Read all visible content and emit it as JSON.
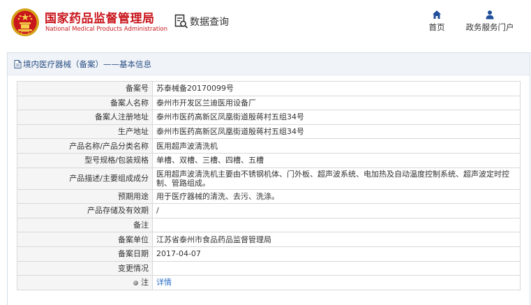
{
  "header": {
    "title_cn": "国家药品监督管理局",
    "title_en": "National Medical Products Administration",
    "query_label": "数据查询",
    "nav": {
      "home": "首页",
      "portal": "政务服务门户"
    }
  },
  "breadcrumb": "境内医疗器械（备案）——基本信息",
  "rows": [
    {
      "label": "备案号",
      "value": "苏泰械备20170099号"
    },
    {
      "label": "备案人名称",
      "value": "泰州市开发区兰迪医用设备厂"
    },
    {
      "label": "备案人注册地址",
      "value": "泰州市医药高新区凤凰街道殷蒋村五组34号"
    },
    {
      "label": "生产地址",
      "value": "泰州市医药高新区凤凰街道殷蒋村五组34号"
    },
    {
      "label": "产品名称/产品分类名称",
      "value": "医用超声波清洗机"
    },
    {
      "label": "型号规格/包装规格",
      "value": "单槽、双槽、三槽、四槽、五槽"
    },
    {
      "label": "产品描述/主要组成成分",
      "value": "医用超声波清洗机主要由不锈钢机体、门外板、超声波系统、电加热及自动温度控制系统、超声波定时控制、管路组成。"
    },
    {
      "label": "预期用途",
      "value": "用于医疗器械的清洗、去污、洗涤。"
    },
    {
      "label": "产品存储及有效期",
      "value": "/"
    },
    {
      "label": "备注",
      "value": ""
    },
    {
      "label": "备案单位",
      "value": "江苏省泰州市食品药品监督管理局"
    },
    {
      "label": "备案日期",
      "value": "2017-04-07"
    },
    {
      "label": "变更情况",
      "value": ""
    },
    {
      "label": "注",
      "value": "详情"
    }
  ],
  "colors": {
    "brand_red": "#c9161c",
    "link_blue": "#2a6ec6",
    "nav_blue": "#1f4f9b"
  },
  "icons": {
    "emblem": "national-emblem",
    "query": "search-document-icon",
    "home": "home-icon",
    "portal": "user-icon",
    "breadcrumb": "document-icon",
    "note": "bullet-dot-icon"
  }
}
